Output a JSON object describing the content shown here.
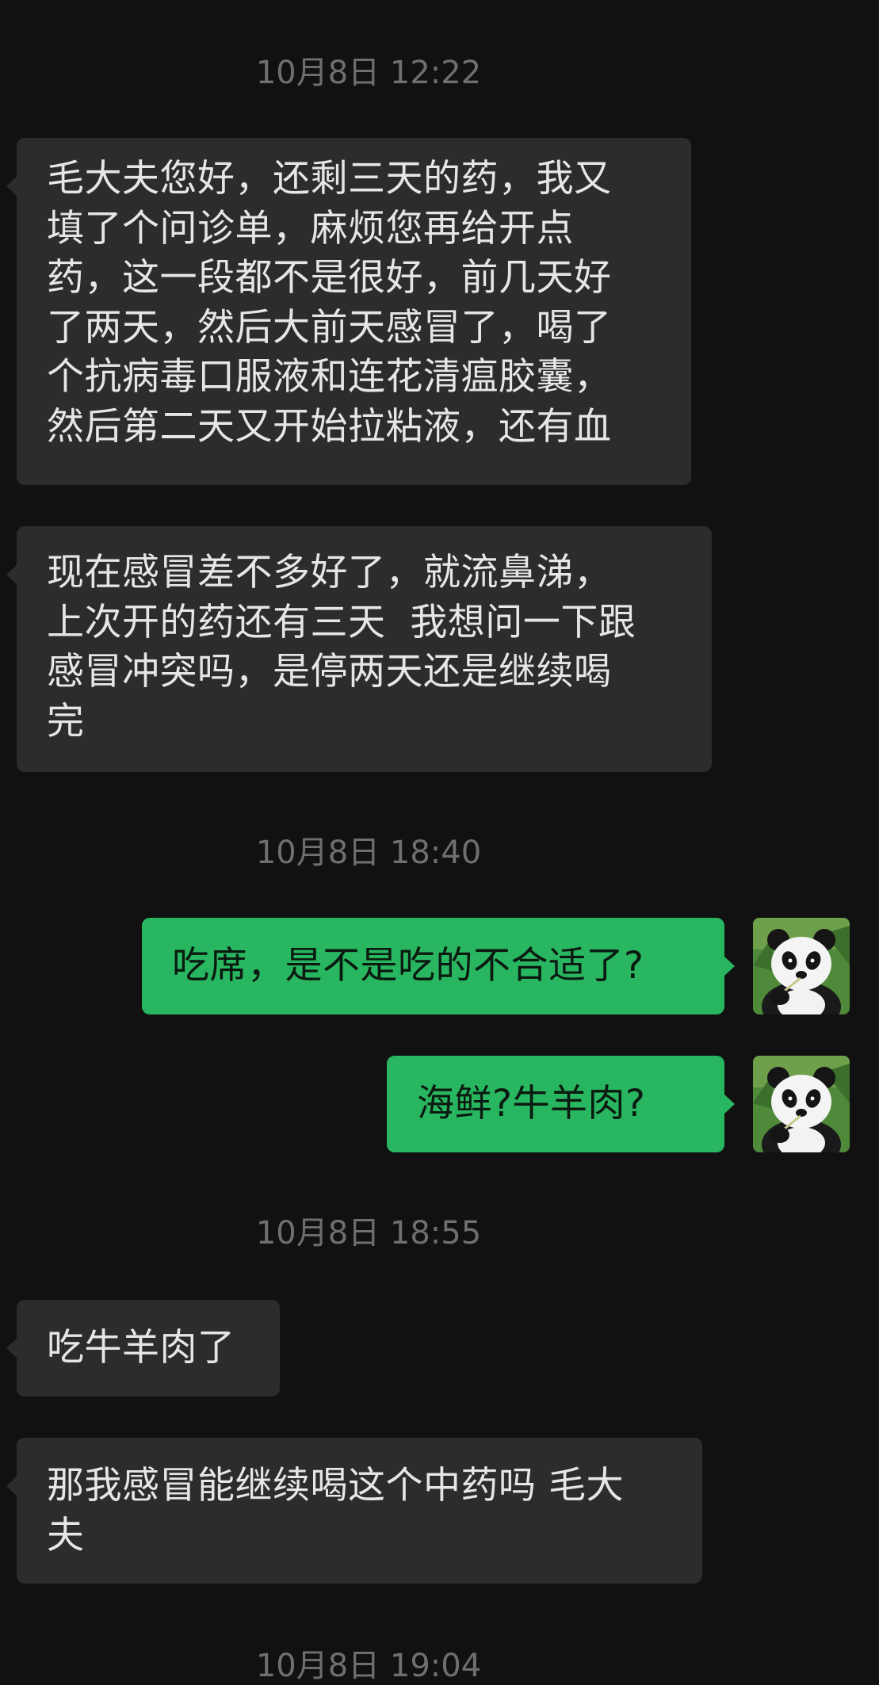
{
  "colors": {
    "background": "#111111",
    "incoming_bubble": "#2c2c2c",
    "outgoing_bubble": "#29b660",
    "timestamp_text": "#6f6f6f"
  },
  "messages": [
    {
      "type": "timestamp",
      "text": "10月8日 12:22"
    },
    {
      "type": "incoming",
      "text": "毛大夫您好，还剩三天的药，我又\n填了个问诊单，麻烦您再给开点\n药，这一段都不是很好，前几天好\n了两天，然后大前天感冒了，喝了\n个抗病毒口服液和连花清瘟胶囊，\n然后第二天又开始拉粘液，还有血"
    },
    {
      "type": "incoming",
      "text": "现在感冒差不多好了，就流鼻涕，\n上次开的药还有三天  我想问一下跟\n感冒冲突吗，是停两天还是继续喝\n完"
    },
    {
      "type": "timestamp",
      "text": "10月8日 18:40"
    },
    {
      "type": "outgoing",
      "text": "吃席，是不是吃的不合适了?",
      "avatar": "panda-avatar-icon"
    },
    {
      "type": "outgoing",
      "text": "海鲜?牛羊肉?",
      "avatar": "panda-avatar-icon"
    },
    {
      "type": "timestamp",
      "text": "10月8日 18:55"
    },
    {
      "type": "incoming",
      "text": "吃牛羊肉了"
    },
    {
      "type": "incoming",
      "text": "那我感冒能继续喝这个中药吗 毛大\n夫"
    },
    {
      "type": "timestamp",
      "text": "10月8日 19:04"
    }
  ]
}
